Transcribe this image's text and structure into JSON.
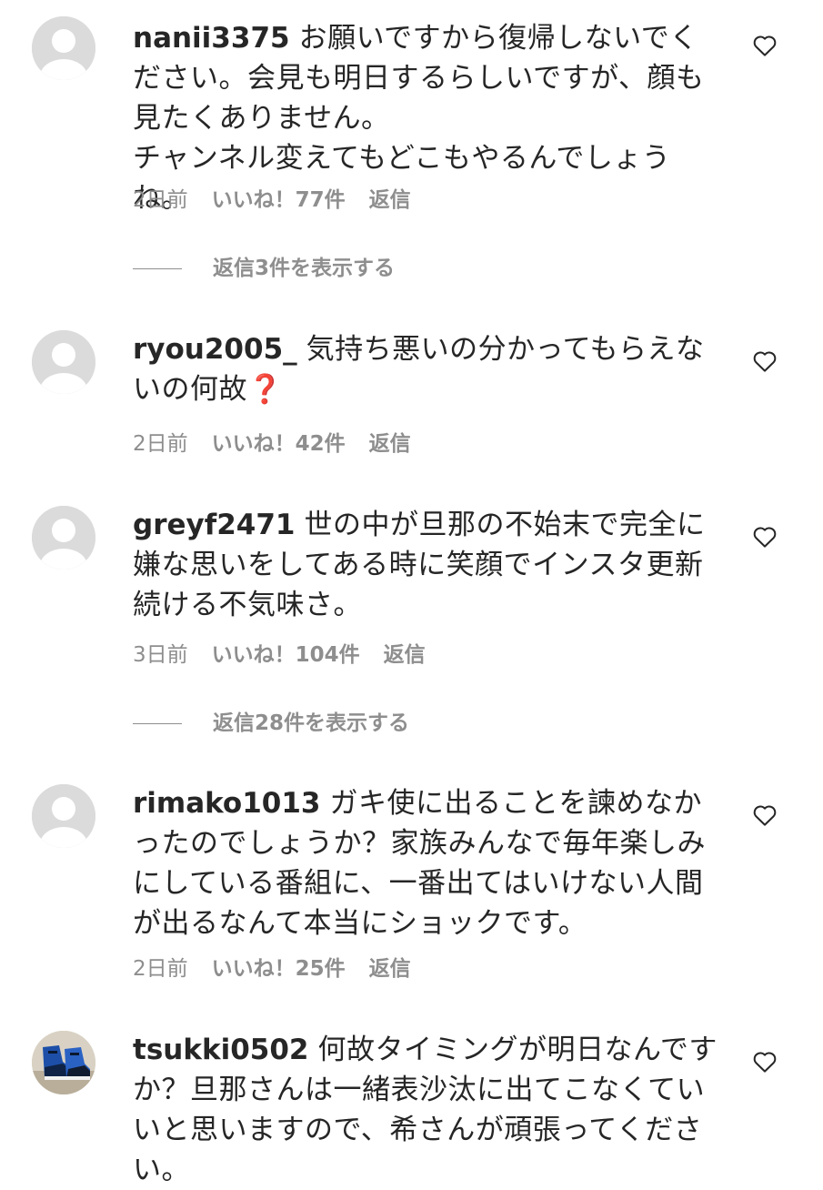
{
  "comments": [
    {
      "username": "nanii3375",
      "text": "お願いですから復帰しないでください。会見も明日するらしいですが、顔も見たくありません。",
      "text2": "チャンネル変えてもどこもやるんでしょうね。",
      "time": "2日前",
      "likes": "いいね！77件",
      "reply": "返信",
      "view_replies": "返信3件を表示する",
      "avatar_icon": "default-avatar-icon"
    },
    {
      "username": "ryou2005_",
      "text": "気持ち悪いの分かってもらえないの何故",
      "emoji": "❓",
      "time": "2日前",
      "likes": "いいね！42件",
      "reply": "返信",
      "avatar_icon": "default-avatar-icon"
    },
    {
      "username": "greyf2471",
      "text": "世の中が旦那の不始末で完全に嫌な思いをしてある時に笑顔でインスタ更新続ける不気味さ。",
      "time": "3日前",
      "likes": "いいね！104件",
      "reply": "返信",
      "view_replies": "返信28件を表示する",
      "avatar_icon": "default-avatar-icon"
    },
    {
      "username": "rimako1013",
      "text": "ガキ使に出ることを諫めなかったのでしょうか？家族みんなで毎年楽しみにしている番組に、一番出てはいけない人間が出るなんて本当にショックです。",
      "time": "2日前",
      "likes": "いいね！25件",
      "reply": "返信",
      "avatar_icon": "default-avatar-icon"
    },
    {
      "username": "tsukki0502",
      "text": "何故タイミングが明日なんですか？旦那さんは一緒表沙汰に出てこなくていいと思いますので、希さんが頑張ってください。",
      "avatar_icon": "sneaker-photo-avatar"
    }
  ],
  "icons": {
    "like": "heart-outline-icon"
  },
  "colors": {
    "text": "#262626",
    "meta": "#8e8e8e",
    "avatar_bg": "#dbdbdb",
    "emoji_red": "#d81b2a"
  }
}
